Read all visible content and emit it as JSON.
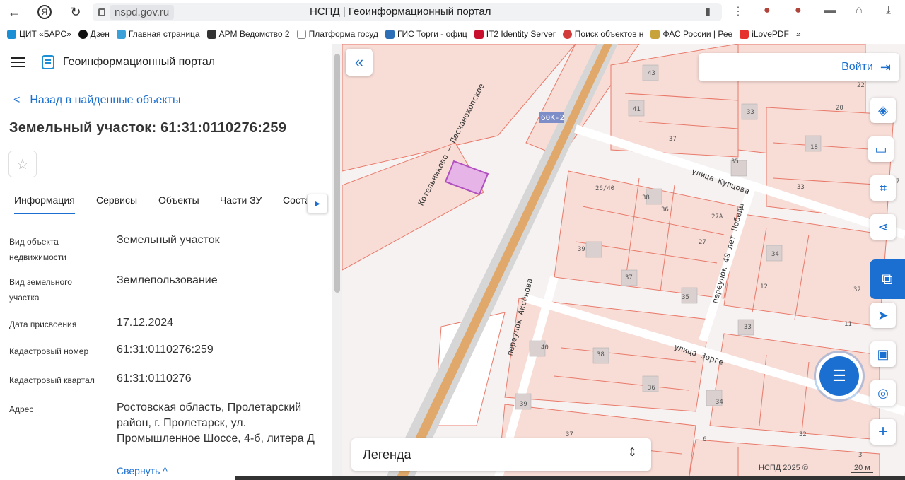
{
  "browser": {
    "host": "nspd.gov.ru",
    "page_title": "НСПД | Геоинформационный портал",
    "back_icon": "arrow-left",
    "yandex_icon": "Я",
    "reload_icon": "reload"
  },
  "bookmarks": [
    {
      "label": "ЦИТ «БАРС»",
      "color": "#1a8fd6"
    },
    {
      "label": "Дзен",
      "color": "#111111"
    },
    {
      "label": "Главная страница",
      "color": "#3aa0d8"
    },
    {
      "label": "АРМ Ведомство 2",
      "color": "#333333"
    },
    {
      "label": "Платформа госуд",
      "color": "#888888"
    },
    {
      "label": "ГИС Торги - офиц",
      "color": "#2d6fb7"
    },
    {
      "label": "IT2 Identity Server",
      "color": "#c8102e"
    },
    {
      "label": "Поиск объектов н",
      "color": "#d33b3b"
    },
    {
      "label": "ФАС России | Рее",
      "color": "#c8a23a"
    },
    {
      "label": "iLovePDF",
      "color": "#e5322d"
    }
  ],
  "panel": {
    "portal_title": "Геоинформационный портал",
    "back_link": "Назад в найденные объекты",
    "title": "Земельный участок: 61:31:0110276:259",
    "tabs": [
      "Информация",
      "Сервисы",
      "Объекты",
      "Части ЗУ",
      "Соста"
    ],
    "fields": [
      {
        "key": "Вид объекта недвижимости",
        "value": "Земельный участок"
      },
      {
        "key": "Вид земельного участка",
        "value": "Землепользование"
      },
      {
        "key": "Дата присвоения",
        "value": "17.12.2024"
      },
      {
        "key": "Кадастровый номер",
        "value": "61:31:0110276:259"
      },
      {
        "key": "Кадастровый квартал",
        "value": "61:31:0110276"
      },
      {
        "key": "Адрес",
        "value": "Ростовская область, Пролетарский район, г. Пролетарск, ул. Промышленное Шоссе, 4-б, литера Д"
      }
    ],
    "collapse_link": "Свернуть"
  },
  "map": {
    "login": "Войти",
    "legend": "Легенда",
    "copyright": "НСПД 2025 ©",
    "scale": "20 м",
    "road_badge": "60К-2",
    "road_label": "Котельниково — Песчанокопское",
    "streets": [
      "улица Купцова",
      "переулок 40 лет Победы",
      "переулок Аксёнова",
      "улица Зорге"
    ],
    "parcel_numbers": [
      "43",
      "41",
      "33",
      "37",
      "35",
      "18",
      "20",
      "33",
      "26/40",
      "38",
      "36",
      "27А",
      "27",
      "39",
      "37",
      "35",
      "34",
      "12",
      "33",
      "11",
      "32",
      "40",
      "38",
      "36",
      "39",
      "34",
      "37",
      "6",
      "32",
      "22",
      "7",
      "3"
    ]
  },
  "colors": {
    "accent": "#1a6fd0",
    "parcel": "#e87a6a",
    "road": "#e0a86a",
    "selected": "#b04fc0"
  }
}
